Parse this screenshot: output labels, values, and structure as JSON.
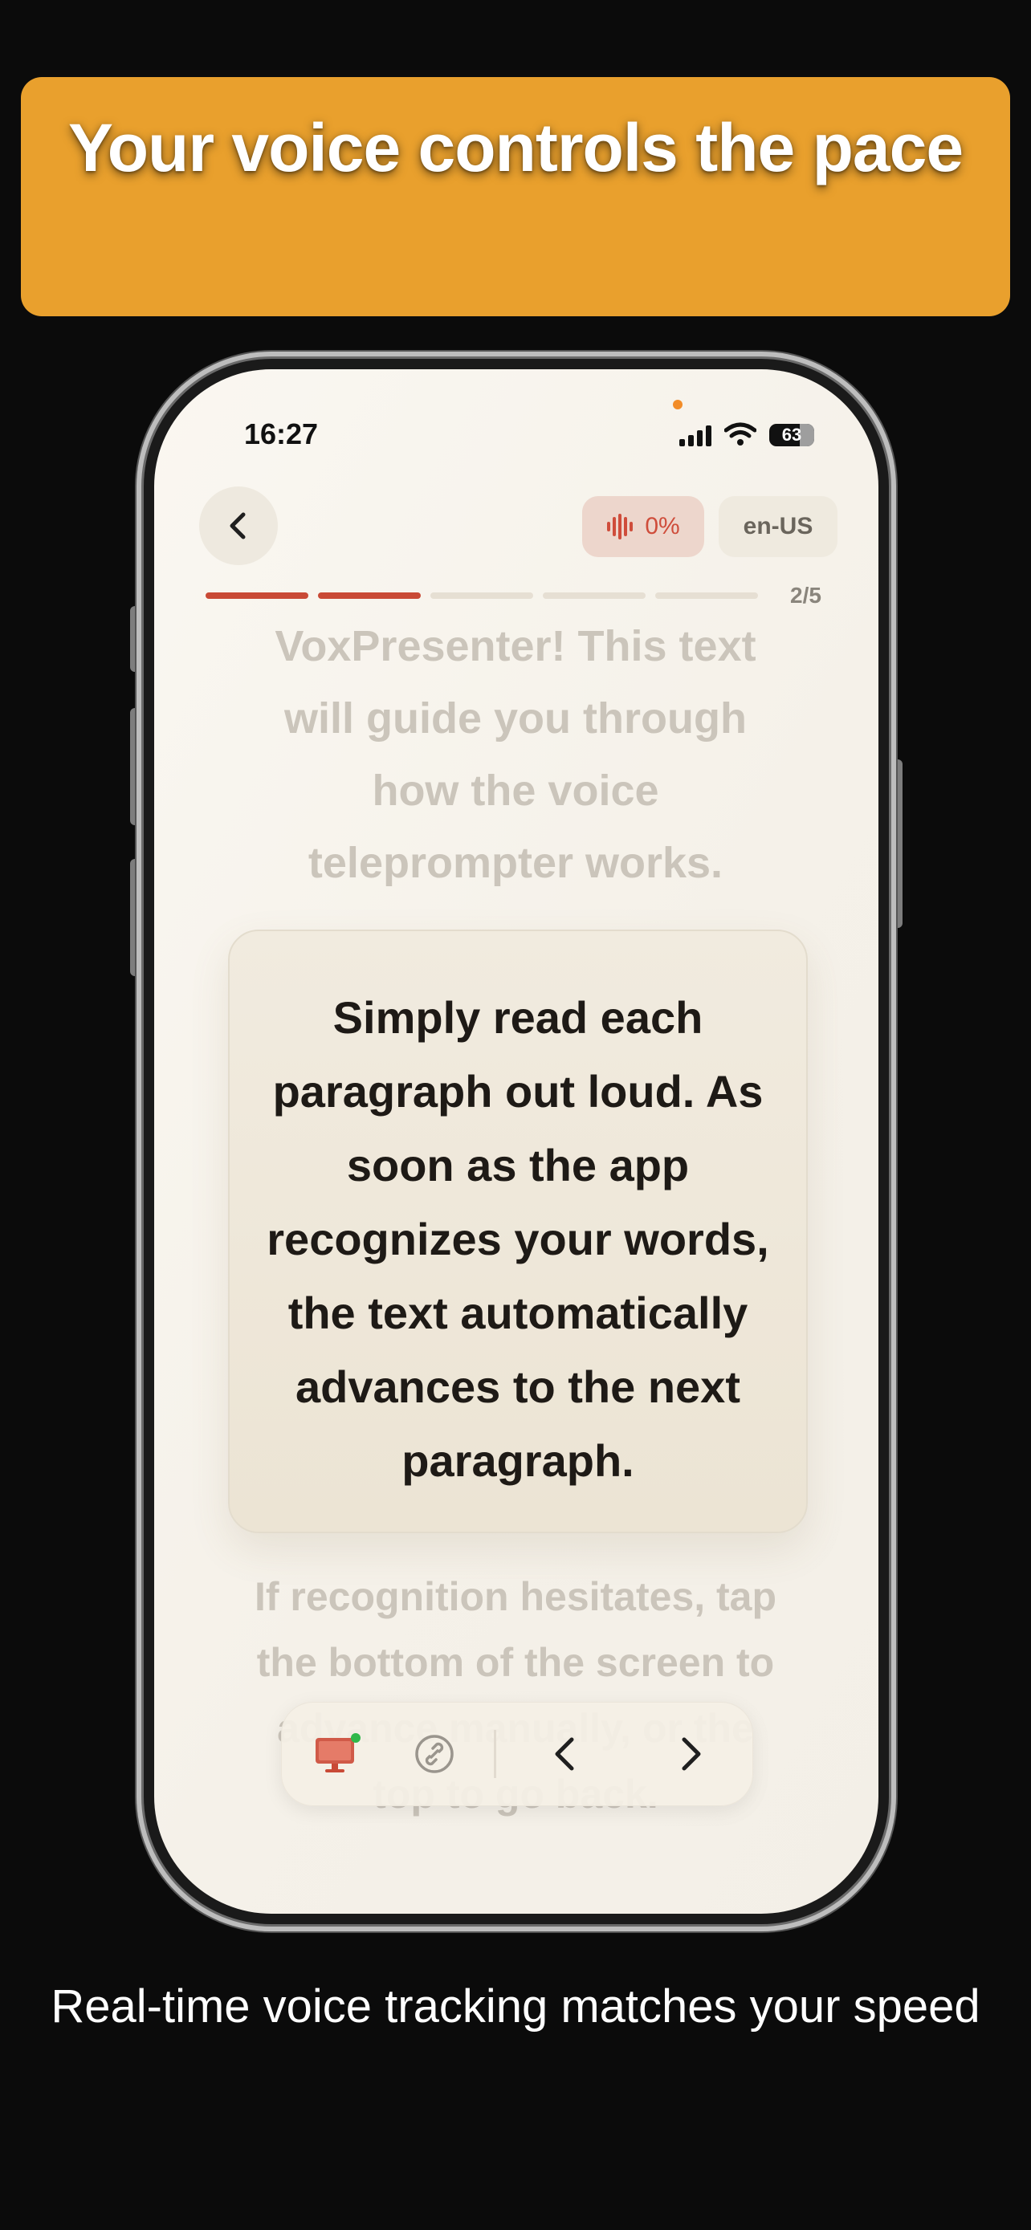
{
  "headline": {
    "text": "Your voice controls the pace"
  },
  "status_bar": {
    "time": "16:27",
    "battery": "63"
  },
  "top_bar": {
    "voice_level": "0%",
    "language": "en-US"
  },
  "progress": {
    "current": 2,
    "total": 5,
    "label": "2/5"
  },
  "script": {
    "previous_paragraph": "VoxPresenter! This text will guide you through how the voice teleprompter works.",
    "active_paragraph": "Simply read each paragraph out loud. As soon as the app recognizes your words, the text automatically advances to the next paragraph.",
    "next_paragraph": "If recognition hesitates, tap the bottom of the screen to advance manually, or the top to go back."
  },
  "controls": {
    "icons": [
      "monitor-icon",
      "link-icon",
      "chevron-left-icon",
      "chevron-right-icon"
    ],
    "monitor_status_color": "#2fb84a"
  },
  "caption": {
    "text": "Real-time voice tracking matches your speed"
  },
  "colors": {
    "banner": "#e9a02d",
    "accent": "#c94a36",
    "background": "#0b0b0b"
  }
}
